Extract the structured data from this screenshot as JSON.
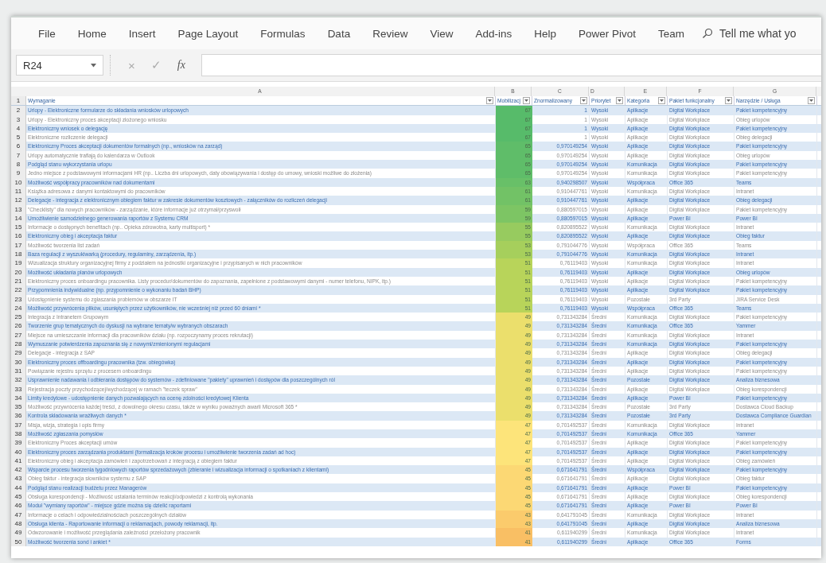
{
  "ribbon": {
    "tabs": [
      "File",
      "Home",
      "Insert",
      "Page Layout",
      "Formulas",
      "Data",
      "Review",
      "View",
      "Add-ins",
      "Help",
      "Power Pivot",
      "Team"
    ],
    "search_text": "Tell me what yo"
  },
  "formula_bar": {
    "name_box": "R24",
    "cancel": "×",
    "enter": "✓",
    "function": "fx"
  },
  "sheet": {
    "column_letters": [
      "A",
      "B",
      "C",
      "D",
      "E",
      "F",
      "G"
    ],
    "header_row": "1",
    "headers": [
      "Wymaganie",
      "Mobilizacj",
      "Znormalizowany",
      "Priorytet",
      "Kategoria",
      "Pakiet funkcjonalny",
      "Narzędzie / Usługa"
    ],
    "rows": [
      {
        "number": "2",
        "color": "#57bb6a",
        "cells": [
          "Urlopy - Elektroniczne formularze do składania wniosków urlopowych",
          "67",
          "1",
          "Wysoki",
          "Aplikacje",
          "Digital Workplace",
          "Pakiet kompetencyjny"
        ]
      },
      {
        "number": "3",
        "color": "#57bb6a",
        "cells": [
          "Urlopy - Elektroniczny proces akceptacji złożonego wniosku",
          "67",
          "1",
          "Wysoki",
          "Aplikacje",
          "Digital Workplace",
          "Obieg urlopów"
        ]
      },
      {
        "number": "4",
        "color": "#57bb6a",
        "cells": [
          "Elektroniczny wniosek o delegację",
          "67",
          "1",
          "Wysoki",
          "Aplikacje",
          "Digital Workplace",
          "Pakiet kompetencyjny"
        ]
      },
      {
        "number": "5",
        "color": "#57bb6a",
        "cells": [
          "Elektroniczne rozliczenie delegacji",
          "67",
          "1",
          "Wysoki",
          "Aplikacje",
          "Digital Workplace",
          "Obieg delegacji"
        ]
      },
      {
        "number": "6",
        "color": "#5fbd69",
        "cells": [
          "Elektroniczny Proces akceptacji dokumentów formalnych (np., wniosków na zarząd)",
          "65",
          "0,970149254",
          "Wysoki",
          "Aplikacje",
          "Digital Workplace",
          "Pakiet kompetencyjny"
        ]
      },
      {
        "number": "7",
        "color": "#5fbd69",
        "cells": [
          "Urlopy automatycznie trafiają do kalendarza w Outlook",
          "65",
          "0,970149254",
          "Wysoki",
          "Aplikacje",
          "Digital Workplace",
          "Obieg urlopów"
        ]
      },
      {
        "number": "8",
        "color": "#5fbd69",
        "cells": [
          "Podgląd stanu wykorzystania urlopu",
          "65",
          "0,970149254",
          "Wysoki",
          "Komunikacja",
          "Digital Workplace",
          "Pakiet kompetencyjny"
        ]
      },
      {
        "number": "9",
        "color": "#5fbd69",
        "cells": [
          "Jedno miejsce z podstawowymi informacjami HR (np.. Liczba dni urlopowych, daty obowiązywania i dostęp do umowy, wnioski możliwe do złożenia)",
          "65",
          "0,970149254",
          "Wysoki",
          "Komunikacja",
          "Digital Workplace",
          "Pakiet kompetencyjny"
        ]
      },
      {
        "number": "10",
        "color": "#68c068",
        "cells": [
          "Możliwość współpracy pracowników nad dokumentami",
          "63",
          "0,940298507",
          "Wysoki",
          "Współpraca",
          "Office 365",
          "Teams"
        ]
      },
      {
        "number": "11",
        "color": "#72c266",
        "cells": [
          "Książka adresowa z danymi kontaktowymi do pracowników",
          "61",
          "0,910447761",
          "Wysoki",
          "Komunikacja",
          "Digital Workplace",
          "Intranet"
        ]
      },
      {
        "number": "12",
        "color": "#72c266",
        "cells": [
          "Delegacje - integracja z elektronicznym obiegiem faktur w zakresie dokumentów kosztowych - załączników do rozliczeń delegacji",
          "61",
          "0,910447761",
          "Wysoki",
          "Aplikacje",
          "Digital Workplace",
          "Obieg delegacji"
        ]
      },
      {
        "number": "13",
        "color": "#7dc564",
        "cells": [
          "\"Checklisty\" dla nowych pracowników - zarządzanie, które informacje już otrzymał/przyswoił",
          "59",
          "0,880597015",
          "Wysoki",
          "Aplikacje",
          "Digital Workplace",
          "Pakiet kompetencyjny"
        ]
      },
      {
        "number": "14",
        "color": "#7dc564",
        "cells": [
          "Umożliwienie samodzielnego generowania raportów z Systemu CRM",
          "59",
          "0,880597015",
          "Wysoki",
          "Aplikacje",
          "Power BI",
          "Power BI"
        ]
      },
      {
        "number": "15",
        "color": "#97cb5f",
        "cells": [
          "Informacje o dostępnych benefitach (np.. Opieka zdrowotna, karty multisport) *",
          "55",
          "0,820895522",
          "Wysoki",
          "Komunikacja",
          "Digital Workplace",
          "Intranet"
        ]
      },
      {
        "number": "16",
        "color": "#97cb5f",
        "cells": [
          "Elektroniczny obieg i akceptacja faktur",
          "55",
          "0,820895522",
          "Wysoki",
          "Aplikacje",
          "Digital Workplace",
          "Obieg faktur"
        ]
      },
      {
        "number": "17",
        "color": "#a6cf5c",
        "cells": [
          "Możliwość tworzenia list zadań",
          "53",
          "0,791044776",
          "Wysoki",
          "Współpraca",
          "Office 365",
          "Teams"
        ]
      },
      {
        "number": "18",
        "color": "#a6cf5c",
        "cells": [
          "Baza regulacji z wyszukiwarką (procedury, regulaminy, zarządzenia, itp.)",
          "53",
          "0,791044776",
          "Wysoki",
          "Komunikacja",
          "Digital Workplace",
          "Intranet"
        ]
      },
      {
        "number": "19",
        "color": "#b8d45a",
        "cells": [
          "Wizualizacja struktury organizacyjnej firmy z podziałem na jednostki organizacyjne i przypisanych w nich pracowników",
          "51",
          "0,76119403",
          "Wysoki",
          "Komunikacja",
          "Digital Workplace",
          "Intranet"
        ]
      },
      {
        "number": "20",
        "color": "#b8d45a",
        "cells": [
          "Możliwość układania planów urlopowych",
          "51",
          "0,76119403",
          "Wysoki",
          "Aplikacje",
          "Digital Workplace",
          "Obieg urlopów"
        ]
      },
      {
        "number": "21",
        "color": "#b8d45a",
        "cells": [
          "Elektroniczny proces onboardingu pracownika. Listy procedur/dokumentów do zapoznania, zapełnione z podstawowymi danymi - numer telefonu, NIPK, itp.)",
          "51",
          "0,76119403",
          "Wysoki",
          "Aplikacje",
          "Digital Workplace",
          "Pakiet kompetencyjny"
        ]
      },
      {
        "number": "22",
        "color": "#b8d45a",
        "cells": [
          "Przypomnienia indywidualne (np. przypomnienie o wykonaniu badań BHP)",
          "51",
          "0,76119403",
          "Wysoki",
          "Aplikacje",
          "Digital Workplace",
          "Pakiet kompetencyjny"
        ]
      },
      {
        "number": "23",
        "color": "#b8d45a",
        "cells": [
          "Udostępnienie systemu do zgłaszania problemów w obszarze IT",
          "51",
          "0,76119403",
          "Wysoki",
          "Pozostałe",
          "3rd Party",
          "JIRA Service Desk"
        ]
      },
      {
        "number": "24",
        "color": "#b8d45a",
        "cells": [
          "Możliwość przywrócenia plików, usuniętych przez użytkowników, nie wcześniej niż przed 60 dniami *",
          "51",
          "0,76119403",
          "Wysoki",
          "Współpraca",
          "Office 365",
          "Teams"
        ]
      },
      {
        "number": "25",
        "color": "#ebdf6c",
        "cells": [
          "Integracja z Intranetem Grupowym",
          "49",
          "0,731343284",
          "Średni",
          "Komunikacja",
          "Digital Workplace",
          "Pakiet kompetencyjny"
        ]
      },
      {
        "number": "26",
        "color": "#ebdf6c",
        "cells": [
          "Tworzenie grup tematycznych do dyskusji na wybrane tematy/w wybranych obszarach",
          "49",
          "0,731343284",
          "Średni",
          "Komunikacja",
          "Office 365",
          "Yammer"
        ]
      },
      {
        "number": "27",
        "color": "#ebdf6c",
        "cells": [
          "Miejsce na umieszczanie informacji dla pracowników działu (np. rozpoczynamy proces rekrutacji)",
          "49",
          "0,731343284",
          "Średni",
          "Komunikacja",
          "Digital Workplace",
          "Intranet"
        ]
      },
      {
        "number": "28",
        "color": "#ebdf6c",
        "cells": [
          "Wymuszanie potwierdzenia zapoznania się z nowymi/zmienionymi regulacjami",
          "49",
          "0,731343284",
          "Średni",
          "Komunikacja",
          "Digital Workplace",
          "Pakiet kompetencyjny"
        ]
      },
      {
        "number": "29",
        "color": "#ebdf6c",
        "cells": [
          "Delegacje - integracja z SAP",
          "49",
          "0,731343284",
          "Średni",
          "Aplikacje",
          "Digital Workplace",
          "Obieg delegacji"
        ]
      },
      {
        "number": "30",
        "color": "#ebdf6c",
        "cells": [
          "Elektroniczny proces offboardingu pracownika (tzw. obiegówka)",
          "49",
          "0,731343284",
          "Średni",
          "Aplikacje",
          "Digital Workplace",
          "Pakiet kompetencyjny"
        ]
      },
      {
        "number": "31",
        "color": "#ebdf6c",
        "cells": [
          "Powiązanie rejestru sprzętu z procesem onboardingu",
          "49",
          "0,731343284",
          "Średni",
          "Aplikacje",
          "Digital Workplace",
          "Pakiet kompetencyjny"
        ]
      },
      {
        "number": "32",
        "color": "#ebdf6c",
        "cells": [
          "Usprawnienie nadawania i odbierania dostępów do systemów - zdefiniowane \"pakiety\" uprawnień i dostępów dla poszczególnych ról",
          "49",
          "0,731343284",
          "Średni",
          "Pozostałe",
          "Digital Workplace",
          "Analiza biznesowa"
        ]
      },
      {
        "number": "33",
        "color": "#ebdf6c",
        "cells": [
          "Rejestracja poczty przychodzącej/wychodzącej w ramach \"teczek spraw\"",
          "49",
          "0,731343284",
          "Średni",
          "Aplikacje",
          "Digital Workplace",
          "Obieg korespondencji"
        ]
      },
      {
        "number": "34",
        "color": "#ebdf6c",
        "cells": [
          "Limity kredytowe - udostępnienie danych pozwalających na ocenę zdolności kredytowej Klienta",
          "49",
          "0,731343284",
          "Średni",
          "Aplikacje",
          "Power BI",
          "Pakiet kompetencyjny"
        ]
      },
      {
        "number": "35",
        "color": "#ebdf6c",
        "cells": [
          "Możliwość przywrócenia każdej treści, z dowolnego okresu czasu, także w wyniku poważnych awarii Microsoft 365 *",
          "49",
          "0,731343284",
          "Średni",
          "Pozostałe",
          "3rd Party",
          "Dostawca Cloud Backup"
        ]
      },
      {
        "number": "36",
        "color": "#ebdf6c",
        "cells": [
          "Kontrola składowania wrażliwych danych *",
          "49",
          "0,731343284",
          "Średni",
          "Pozostałe",
          "3rd Party",
          "Dostawca Compliance Guardian"
        ]
      },
      {
        "number": "37",
        "color": "#fde47a",
        "cells": [
          "Misja, wizja, strategia i opis firmy",
          "47",
          "0,701492537",
          "Średni",
          "Komunikacja",
          "Digital Workplace",
          "Intranet"
        ]
      },
      {
        "number": "38",
        "color": "#fde47a",
        "cells": [
          "Możliwość zgłaszania pomysłów",
          "47",
          "0,701492537",
          "Średni",
          "Komunikacja",
          "Office 365",
          "Yammer"
        ]
      },
      {
        "number": "39",
        "color": "#fde47a",
        "cells": [
          "Elektroniczny Proces akceptacji umów",
          "47",
          "0,701492537",
          "Średni",
          "Aplikacje",
          "Digital Workplace",
          "Pakiet kompetencyjny"
        ]
      },
      {
        "number": "40",
        "color": "#fde47a",
        "cells": [
          "Elektroniczny proces zarządzania produktami (formalizacja kroków procesu i umożliwienie tworzenia zadań ad hoc)",
          "47",
          "0,701492537",
          "Średni",
          "Aplikacje",
          "Digital Workplace",
          "Pakiet kompetencyjny"
        ]
      },
      {
        "number": "41",
        "color": "#fde47a",
        "cells": [
          "Elektroniczny obieg i akceptacja zamówień i zapotrzebowań z integracją z obiegiem faktur",
          "47",
          "0,701492537",
          "Średni",
          "Aplikacje",
          "Digital Workplace",
          "Obieg zamówień"
        ]
      },
      {
        "number": "42",
        "color": "#fcd874",
        "cells": [
          "Wsparcie procesu tworzenia tygodniowych raportów sprzedażowych (zbieranie i wizualizacja informacji o spotkaniach z klientami)",
          "45",
          "0,671641791",
          "Średni",
          "Współpraca",
          "Digital Workplace",
          "Pakiet kompetencyjny"
        ]
      },
      {
        "number": "43",
        "color": "#fcd874",
        "cells": [
          "Obieg faktur - integracja słowników systemu z SAP",
          "45",
          "0,671641791",
          "Średni",
          "Aplikacje",
          "Digital Workplace",
          "Obieg faktur"
        ]
      },
      {
        "number": "44",
        "color": "#fcd874",
        "cells": [
          "Podgląd stanu realizacji budżetu przez Managerów",
          "45",
          "0,671641791",
          "Średni",
          "Aplikacje",
          "Power BI",
          "Pakiet kompetencyjny"
        ]
      },
      {
        "number": "45",
        "color": "#fcd874",
        "cells": [
          "Obsługa korespondencji - Możliwość ustalania terminów reakcji/odpowiedzi z kontrolą wykonania",
          "45",
          "0,671641791",
          "Średni",
          "Aplikacje",
          "Digital Workplace",
          "Obieg korespondencji"
        ]
      },
      {
        "number": "46",
        "color": "#fcd874",
        "cells": [
          "Moduł \"wymiany raportów\" - miejsce gdzie można się dzielić raportami",
          "45",
          "0,671641791",
          "Średni",
          "Aplikacje",
          "Power BI",
          "Power BI"
        ]
      },
      {
        "number": "47",
        "color": "#fbcb6c",
        "cells": [
          "Informacje o celach i odpowiedzialnościach poszczególnych działów",
          "43",
          "0,641791045",
          "Średni",
          "Komunikacja",
          "Digital Workplace",
          "Intranet"
        ]
      },
      {
        "number": "48",
        "color": "#fbcb6c",
        "cells": [
          "Obsługa klienta - Raportowanie informacji o reklamacjach, powody reklamacji, itp.",
          "43",
          "0,641791045",
          "Średni",
          "Aplikacje",
          "Digital Workplace",
          "Analiza biznesowa"
        ]
      },
      {
        "number": "49",
        "color": "#f9bf64",
        "cells": [
          "Odwzorowanie i możliwość przeglądania zależności przełożony pracownik",
          "41",
          "0,611940299",
          "Średni",
          "Komunikacja",
          "Digital Workplace",
          "Intranet"
        ]
      },
      {
        "number": "50",
        "color": "#f9bf64",
        "cells": [
          "Możliwość tworzenia sond i ankiet *",
          "41",
          "0,611940299",
          "Średni",
          "Aplikacje",
          "Office 365",
          "Forms"
        ]
      }
    ]
  }
}
